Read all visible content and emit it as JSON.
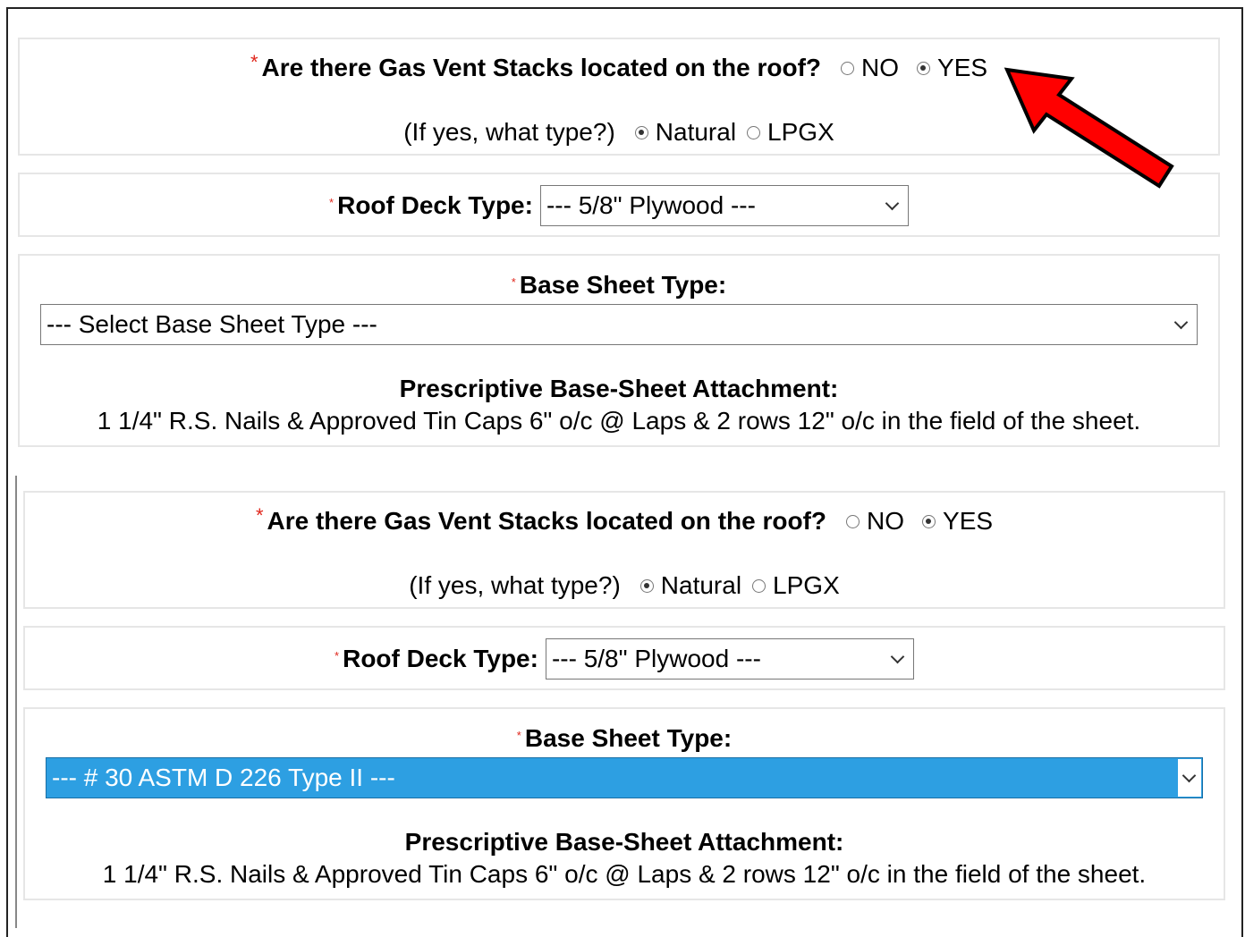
{
  "sections": [
    {
      "gas_question": "Are there Gas Vent Stacks located on the roof?",
      "gas_no": "NO",
      "gas_yes": "YES",
      "gas_selected": "YES",
      "type_prompt": "(If yes, what type?)",
      "type_natural": "Natural",
      "type_lpgx": "LPGX",
      "type_selected": "Natural",
      "roof_deck_label": "Roof Deck Type:",
      "roof_deck_value": "--- 5/8\" Plywood ---",
      "base_sheet_label": "Base Sheet Type:",
      "base_sheet_value": "--- Select Base Sheet Type ---",
      "attachment_title": "Prescriptive Base-Sheet Attachment:",
      "attachment_text": "1 1/4\" R.S. Nails & Approved Tin Caps 6\" o/c @ Laps & 2 rows 12\" o/c in the field of the sheet."
    },
    {
      "gas_question": "Are there Gas Vent Stacks located on the roof?",
      "gas_no": "NO",
      "gas_yes": "YES",
      "gas_selected": "YES",
      "type_prompt": "(If yes, what type?)",
      "type_natural": "Natural",
      "type_lpgx": "LPGX",
      "type_selected": "Natural",
      "roof_deck_label": "Roof Deck Type:",
      "roof_deck_value": "--- 5/8\" Plywood ---",
      "base_sheet_label": "Base Sheet Type:",
      "base_sheet_value": "--- # 30 ASTM D 226 Type II ---",
      "attachment_title": "Prescriptive Base-Sheet Attachment:",
      "attachment_text": "1 1/4\" R.S. Nails & Approved Tin Caps 6\" o/c @ Laps & 2 rows 12\" o/c in the field of the sheet."
    }
  ],
  "required_marker": "*",
  "colors": {
    "required": "#e0261b",
    "highlight_select": "#2d9fe2",
    "arrow": "#ff0000"
  },
  "icons": {
    "dropdown": "chevron-down-icon",
    "annotation": "red-arrow-icon"
  }
}
